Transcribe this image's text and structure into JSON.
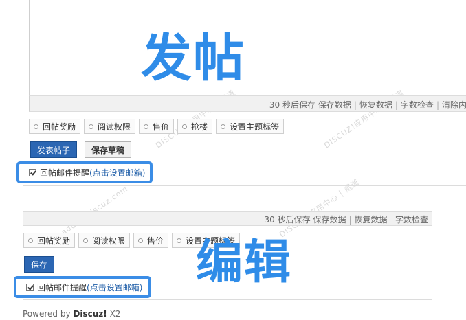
{
  "post_section": {
    "label": "发帖",
    "status_bar": {
      "autosave_text": "30 秒后保存",
      "save_data": "保存数据",
      "restore_data": "恢复数据",
      "word_count": "字数检查",
      "clear": "清除内"
    },
    "tabs": [
      "回帖奖励",
      "阅读权限",
      "售价",
      "抢楼",
      "设置主题标签"
    ],
    "submit_button": "发表帖子",
    "draft_button": "保存草稿",
    "email_reminder": {
      "label": "回帖邮件提醒",
      "link": "(点击设置邮箱)"
    }
  },
  "edit_section": {
    "label": "编辑",
    "status_bar": {
      "autosave_text": "30 秒后保存",
      "save_data": "保存数据",
      "restore_data": "恢复数据",
      "word_count": "字数检查"
    },
    "tabs": [
      "回帖奖励",
      "阅读权限",
      "售价",
      "设置主题标签"
    ],
    "save_button": "保存",
    "email_reminder": {
      "label": "回帖邮件提醒",
      "link": "(点击设置邮箱)"
    }
  },
  "watermarks": [
    "DISCUZ!应用中心 | 贰道",
    "addon.discuz.com"
  ],
  "footer": {
    "powered_by": "Powered by",
    "brand": "Discuz!",
    "version": "X2"
  },
  "colors": {
    "accent": "#2f8ce8",
    "primary_button": "#2b66b3",
    "highlight_border": "#3b8de6"
  }
}
